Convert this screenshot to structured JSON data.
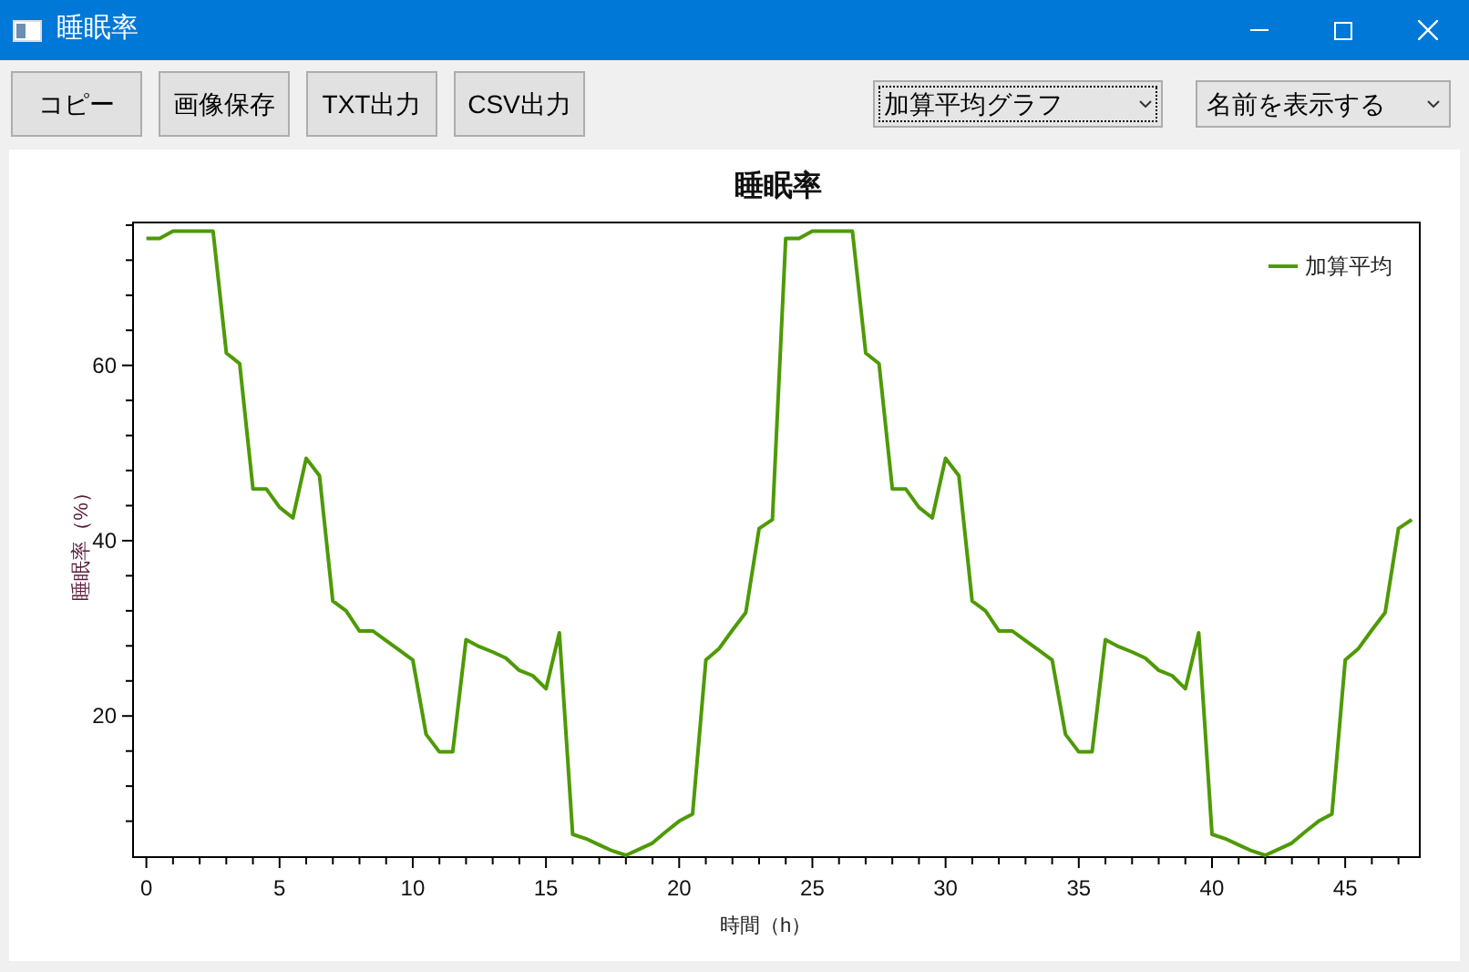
{
  "window": {
    "title": "睡眠率"
  },
  "toolbar": {
    "buttons": [
      "コピー",
      "画像保存",
      "TXT出力",
      "CSV出力"
    ],
    "dropdowns": [
      {
        "value": "加算平均グラフ",
        "focused": true
      },
      {
        "value": "名前を表示する",
        "focused": false
      }
    ]
  },
  "chart": {
    "chart_data": {
      "type": "line",
      "title": "睡眠率",
      "xlabel": "時間（h）",
      "ylabel": "睡眠率（%）",
      "xlim": [
        -0.5,
        47.8
      ],
      "ylim": [
        3.9,
        76.3
      ],
      "xticks": [
        0,
        5,
        10,
        15,
        20,
        25,
        30,
        35,
        40,
        45
      ],
      "yticks": [
        20,
        40,
        60
      ],
      "x": [
        0,
        0.5,
        1,
        1.5,
        2,
        2.5,
        3,
        3.5,
        4,
        4.5,
        5,
        5.5,
        6,
        6.5,
        7,
        7.5,
        8,
        8.5,
        9,
        9.5,
        10,
        10.5,
        11,
        11.5,
        12,
        12.5,
        13,
        13.5,
        14,
        14.5,
        15,
        15.5,
        16,
        16.5,
        17,
        17.5,
        18,
        18.5,
        19,
        19.5,
        20,
        20.5,
        21,
        21.5,
        22,
        22.5,
        23,
        23.5,
        24,
        24.5,
        25,
        25.5,
        26,
        26.5,
        27,
        27.5,
        28,
        28.5,
        29,
        29.5,
        30,
        30.5,
        31,
        31.5,
        32,
        32.5,
        33,
        33.5,
        34,
        34.5,
        35,
        35.5,
        36,
        36.5,
        37,
        37.5,
        38,
        38.5,
        39,
        39.5,
        40,
        40.5,
        41,
        41.5,
        42,
        42.5,
        43,
        43.5,
        44,
        44.5,
        45,
        45.5,
        46,
        46.5,
        47,
        47.5
      ],
      "series": [
        {
          "name": "加算平均",
          "color": "#4e9a06",
          "values": [
            74.5,
            74.5,
            75.3,
            75.3,
            75.3,
            75.3,
            61.4,
            60.2,
            45.9,
            45.9,
            43.8,
            42.6,
            49.4,
            47.4,
            33.1,
            32.0,
            29.7,
            29.7,
            28.6,
            27.5,
            26.4,
            17.9,
            15.9,
            15.9,
            28.7,
            27.9,
            27.3,
            26.6,
            25.2,
            24.6,
            23.1,
            29.5,
            6.5,
            6.0,
            5.3,
            4.6,
            4.1,
            4.8,
            5.5,
            6.8,
            8.0,
            8.8,
            26.4,
            27.7,
            29.8,
            31.8,
            41.4,
            42.4,
            74.5,
            74.5,
            75.3,
            75.3,
            75.3,
            75.3,
            61.4,
            60.2,
            45.9,
            45.9,
            43.8,
            42.6,
            49.4,
            47.4,
            33.1,
            32.0,
            29.7,
            29.7,
            28.6,
            27.5,
            26.4,
            17.9,
            15.9,
            15.9,
            28.7,
            27.9,
            27.3,
            26.6,
            25.2,
            24.6,
            23.1,
            29.5,
            6.5,
            6.0,
            5.3,
            4.6,
            4.1,
            4.8,
            5.5,
            6.8,
            8.0,
            8.8,
            26.4,
            27.7,
            29.8,
            31.8,
            41.4,
            42.4
          ]
        }
      ]
    }
  }
}
